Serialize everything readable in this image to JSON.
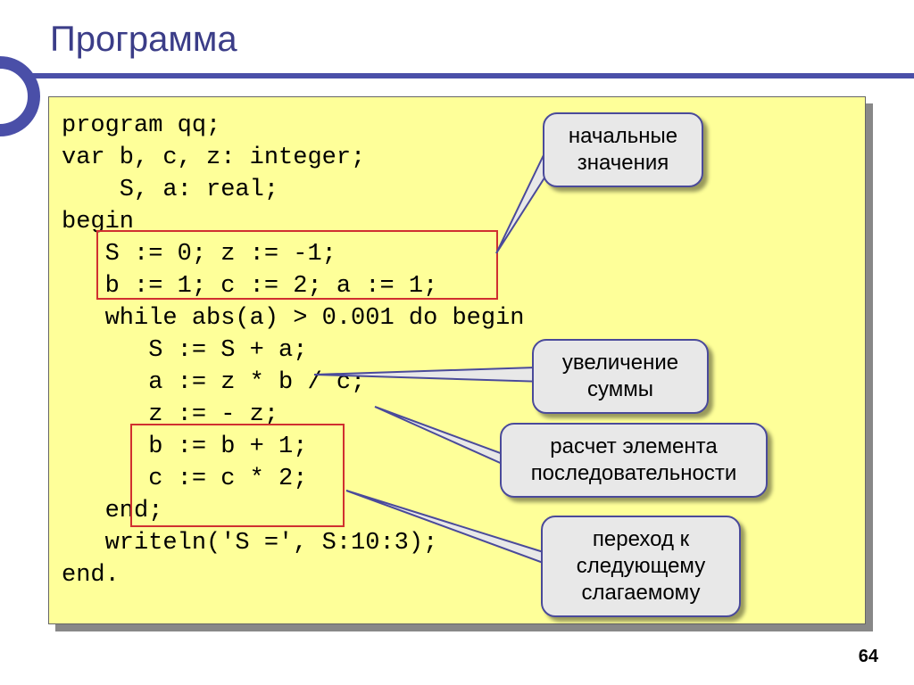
{
  "title": "Программа",
  "code": {
    "l1": "program qq;",
    "l2": "var b, c, z: integer;",
    "l3": "    S, a: real;",
    "l4": "begin",
    "l5": "   S := 0; z := -1;",
    "l6": "   b := 1; c := 2; a := 1;",
    "l7": "   while abs(a) > 0.001 do begin",
    "l8": "      S := S + a;",
    "l9": "      a := z * b / c;",
    "l10": "      z := - z;",
    "l11": "      b := b + 1;",
    "l12": "      c := c * 2;",
    "l13": "   end;",
    "l14": "   writeln('S =', S:10:3);",
    "l15": "end."
  },
  "callouts": {
    "c1": "начальные значения",
    "c2": "увеличение суммы",
    "c3": "расчет элемента последовательности",
    "c4": "переход к следующему слагаемому"
  },
  "page_number": "64"
}
